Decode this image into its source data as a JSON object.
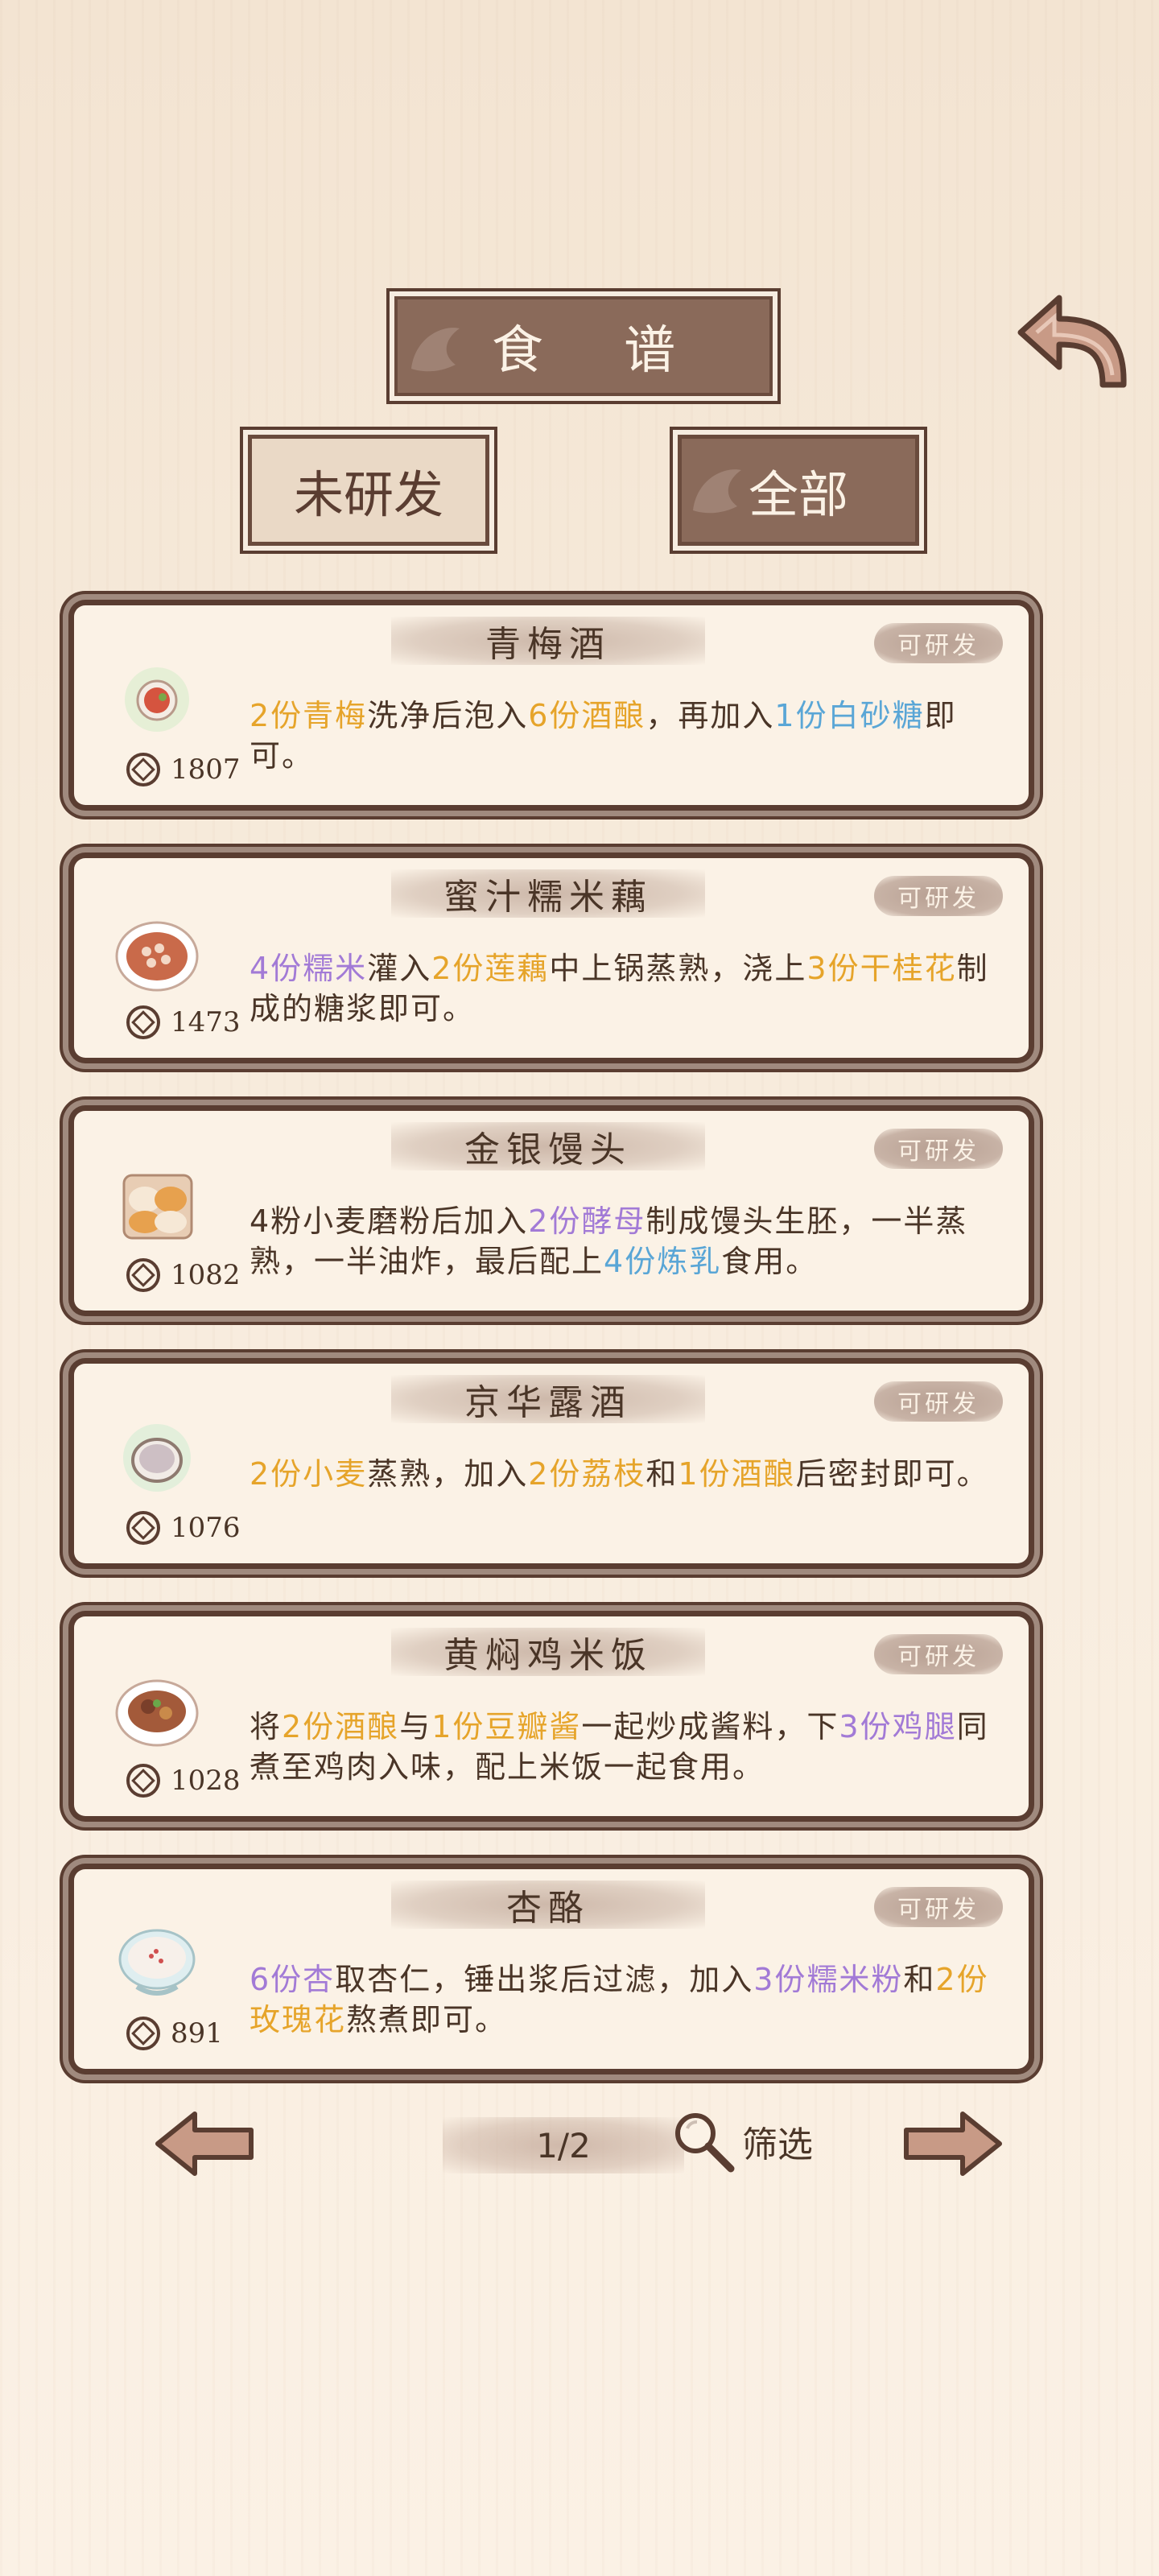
{
  "header": {
    "title": "食 谱",
    "tabs": [
      {
        "label": "未研发",
        "active": false
      },
      {
        "label": "全部",
        "active": true
      }
    ]
  },
  "badge_label": "可研发",
  "recipes": [
    {
      "name": "青梅酒",
      "price": "1807",
      "dish_icon": "plum-wine-cup-icon",
      "desc": [
        {
          "t": "2份青梅",
          "c": "y"
        },
        {
          "t": "洗净后泡入",
          "c": ""
        },
        {
          "t": "6份酒酿",
          "c": "y"
        },
        {
          "t": "，再加入",
          "c": ""
        },
        {
          "t": "1份白砂糖",
          "c": "b"
        },
        {
          "t": "即可。",
          "c": ""
        }
      ]
    },
    {
      "name": "蜜汁糯米藕",
      "price": "1473",
      "dish_icon": "lotus-root-plate-icon",
      "desc": [
        {
          "t": "4份糯米",
          "c": "p"
        },
        {
          "t": "灌入",
          "c": ""
        },
        {
          "t": "2份莲藕",
          "c": "y"
        },
        {
          "t": "中上锅蒸熟，浇上",
          "c": ""
        },
        {
          "t": "3份干桂花",
          "c": "y"
        },
        {
          "t": "制成的糖浆即可。",
          "c": ""
        }
      ]
    },
    {
      "name": "金银馒头",
      "price": "1082",
      "dish_icon": "steamed-buns-icon",
      "desc": [
        {
          "t": "4粉小麦磨粉后加入",
          "c": ""
        },
        {
          "t": "2份酵母",
          "c": "p"
        },
        {
          "t": "制成馒头生胚，一半蒸熟，一半油炸，最后配上",
          "c": ""
        },
        {
          "t": "4份炼乳",
          "c": "b"
        },
        {
          "t": "食用。",
          "c": ""
        }
      ]
    },
    {
      "name": "京华露酒",
      "price": "1076",
      "dish_icon": "wine-bowl-icon",
      "desc": [
        {
          "t": "2份小麦",
          "c": "y"
        },
        {
          "t": "蒸熟，加入",
          "c": ""
        },
        {
          "t": "2份荔枝",
          "c": "y"
        },
        {
          "t": "和",
          "c": ""
        },
        {
          "t": "1份酒酿",
          "c": "y"
        },
        {
          "t": "后密封即可。",
          "c": ""
        }
      ]
    },
    {
      "name": "黄焖鸡米饭",
      "price": "1028",
      "dish_icon": "braised-chicken-bowl-icon",
      "desc": [
        {
          "t": "将",
          "c": ""
        },
        {
          "t": "2份酒酿",
          "c": "y"
        },
        {
          "t": "与",
          "c": ""
        },
        {
          "t": "1份豆瓣酱",
          "c": "y"
        },
        {
          "t": "一起炒成酱料，下",
          "c": ""
        },
        {
          "t": "3份鸡腿",
          "c": "p"
        },
        {
          "t": "同煮至鸡肉入味，配上米饭一起食用。",
          "c": ""
        }
      ]
    },
    {
      "name": "杏酪",
      "price": "891",
      "dish_icon": "almond-pudding-bowl-icon",
      "desc": [
        {
          "t": "6份杏",
          "c": "p"
        },
        {
          "t": "取杏仁，锤出浆后过滤，加入",
          "c": ""
        },
        {
          "t": "3份糯米粉",
          "c": "p"
        },
        {
          "t": "和",
          "c": ""
        },
        {
          "t": "2份玫瑰花",
          "c": "y"
        },
        {
          "t": "熬煮即可。",
          "c": ""
        }
      ]
    }
  ],
  "pager": {
    "page": "1/2",
    "filter_label": "筛选"
  },
  "colors": {
    "frame": "#5a3d31",
    "plaque": "#8a6a5a",
    "card": "#fbf2e6",
    "yellow": "#e6a42a",
    "blue": "#5aa6d6",
    "purple": "#a27ad6"
  }
}
